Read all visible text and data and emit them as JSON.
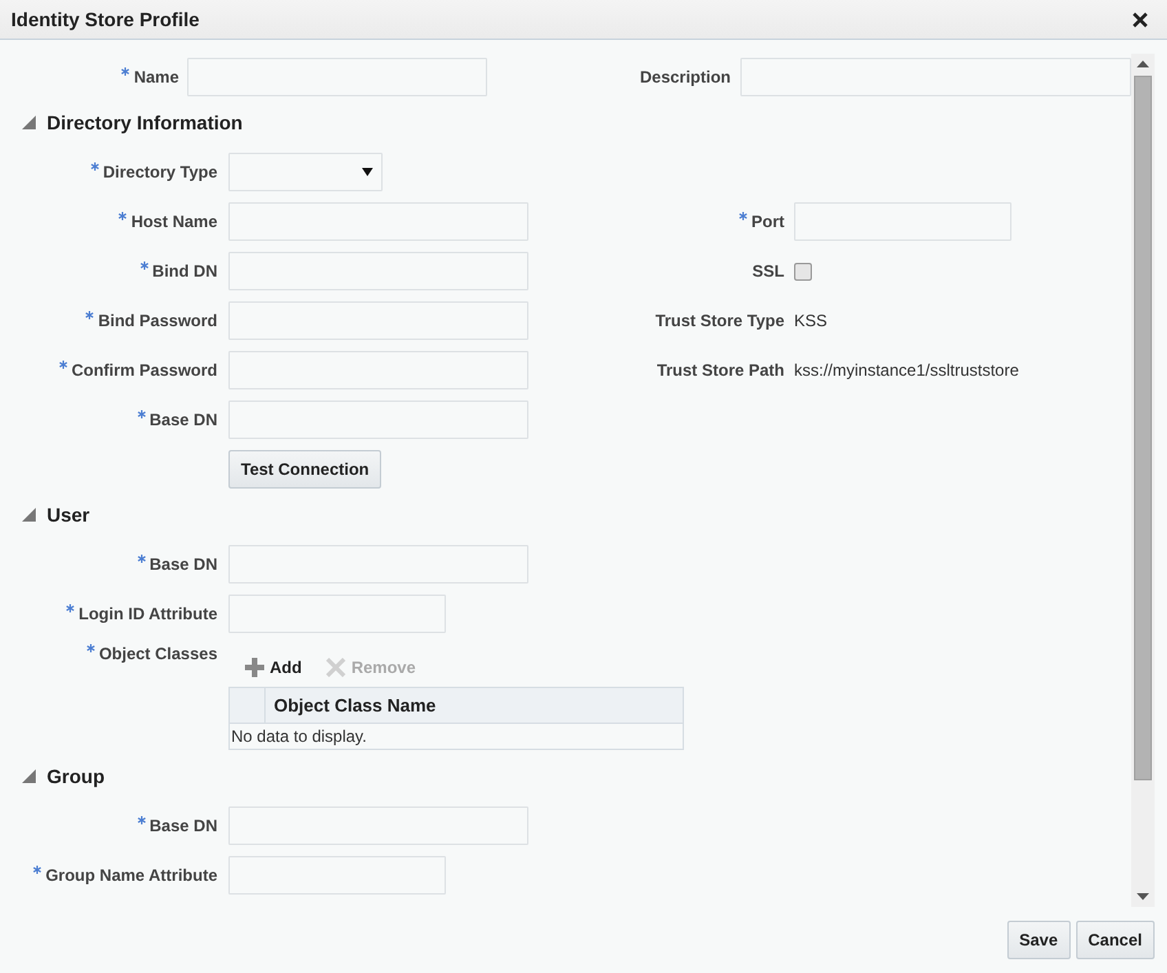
{
  "window": {
    "title": "Identity Store Profile"
  },
  "top_fields": [
    {
      "label": "Name",
      "required": true,
      "kind": "text"
    },
    {
      "label": "Description",
      "required": false,
      "kind": "text"
    }
  ],
  "sections": [
    {
      "title": "Directory Information",
      "expanded": true,
      "fields": [
        {
          "label": "Directory Type",
          "required": true,
          "kind": "select"
        },
        {
          "label": "Host Name",
          "required": true,
          "kind": "text"
        },
        {
          "label": "Bind DN",
          "required": true,
          "kind": "text"
        },
        {
          "label": "Bind Password",
          "required": true,
          "kind": "text"
        },
        {
          "label": "Confirm Password",
          "required": true,
          "kind": "text"
        },
        {
          "label": "Base DN",
          "required": true,
          "kind": "text"
        },
        {
          "kind": "button",
          "button": "Test Connection"
        }
      ],
      "side_fields": [
        {
          "label": "Port",
          "required": true,
          "kind": "short-text"
        },
        {
          "label": "SSL",
          "required": false,
          "kind": "checkbox",
          "checked": false
        },
        {
          "label": "Trust Store Type",
          "required": false,
          "kind": "value",
          "value": "KSS"
        },
        {
          "label": "Trust Store Path",
          "required": false,
          "kind": "value",
          "value": "kss://myinstance1/ssltruststore"
        }
      ]
    },
    {
      "title": "User",
      "expanded": true,
      "fields": [
        {
          "label": "Base DN",
          "required": true,
          "kind": "text"
        },
        {
          "label": "Login ID Attribute",
          "required": true,
          "kind": "short-text"
        },
        {
          "label": "Object Classes",
          "required": true,
          "kind": "list",
          "toolbar": [
            {
              "label": "Add",
              "kind": "add",
              "disabled": false
            },
            {
              "label": "Remove",
              "kind": "remove",
              "disabled": true
            }
          ],
          "columns": [
            "Object Class Name"
          ],
          "empty_text": "No data to display."
        }
      ]
    },
    {
      "title": "Group",
      "expanded": true,
      "fields": [
        {
          "label": "Base DN",
          "required": true,
          "kind": "text"
        },
        {
          "label": "Group Name Attribute",
          "required": true,
          "kind": "short-text"
        }
      ]
    }
  ],
  "buttons": [
    "Save",
    "Cancel"
  ]
}
